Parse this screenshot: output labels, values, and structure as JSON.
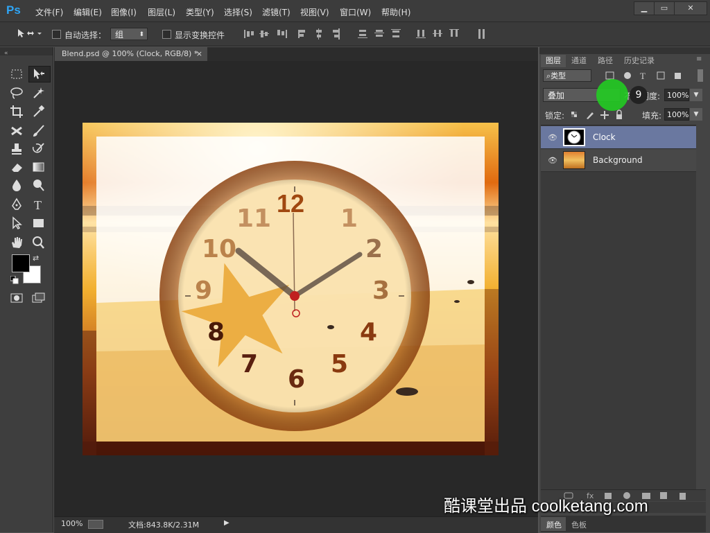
{
  "app": {
    "logo": "Ps"
  },
  "menu": [
    "文件(F)",
    "编辑(E)",
    "图像(I)",
    "图层(L)",
    "类型(Y)",
    "选择(S)",
    "滤镜(T)",
    "视图(V)",
    "窗口(W)",
    "帮助(H)"
  ],
  "window_controls": {
    "minimize": "▁",
    "restore": "▭",
    "close": "✕"
  },
  "options": {
    "auto_select_label": "自动选择：",
    "auto_select_value": "组",
    "show_transform_label": "显示变换控件"
  },
  "document": {
    "tab_title": "Blend.psd @ 100% (Clock, RGB/8) *",
    "tab_close": "×",
    "zoom": "100%",
    "doc_size": "文档:843.8K/2.31M"
  },
  "clock": {
    "numerals": [
      "12",
      "1",
      "2",
      "3",
      "4",
      "5",
      "6",
      "7",
      "8",
      "9",
      "10",
      "11"
    ]
  },
  "layers_panel": {
    "tabs": [
      "图层",
      "通道",
      "路径",
      "历史记录"
    ],
    "filter_kind": "类型",
    "blend_mode": "叠加",
    "opacity_label": "不透明度:",
    "opacity_value": "100%",
    "lock_label": "锁定:",
    "fill_label": "填充:",
    "fill_value": "100%",
    "layers": [
      {
        "name": "Clock",
        "selected": true
      },
      {
        "name": "Background",
        "selected": false
      }
    ]
  },
  "bottom_tabs": [
    "颜色",
    "色板"
  ],
  "click_marker": {
    "number": "9",
    "color": "#22cc22"
  },
  "watermark": "酷课堂出品 coolketang.com",
  "colors": {
    "accent": "#2fa5f5",
    "selected_layer": "#6a78a0"
  }
}
